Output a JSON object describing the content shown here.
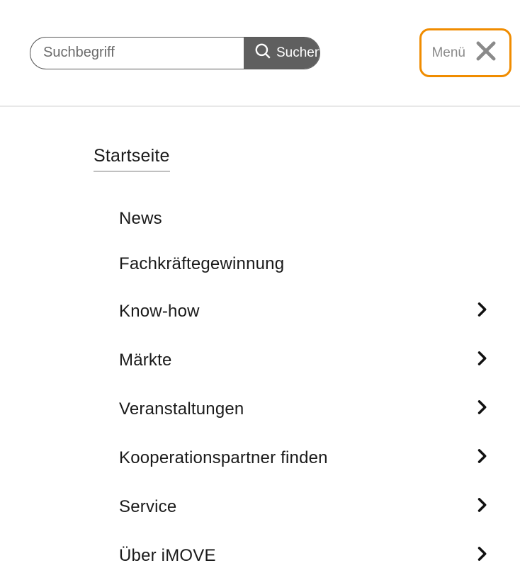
{
  "search": {
    "placeholder": "Suchbegriff",
    "button_label": "Suchen"
  },
  "menu_toggle": {
    "label": "Menü"
  },
  "nav": {
    "root_label": "Startseite",
    "items": [
      {
        "label": "News",
        "has_children": false
      },
      {
        "label": "Fachkräftegewinnung",
        "has_children": false
      },
      {
        "label": "Know-how",
        "has_children": true
      },
      {
        "label": "Märkte",
        "has_children": true
      },
      {
        "label": "Veranstaltungen",
        "has_children": true
      },
      {
        "label": "Kooperationspartner finden",
        "has_children": true
      },
      {
        "label": "Service",
        "has_children": true
      },
      {
        "label": "Über iMOVE",
        "has_children": true
      }
    ]
  }
}
